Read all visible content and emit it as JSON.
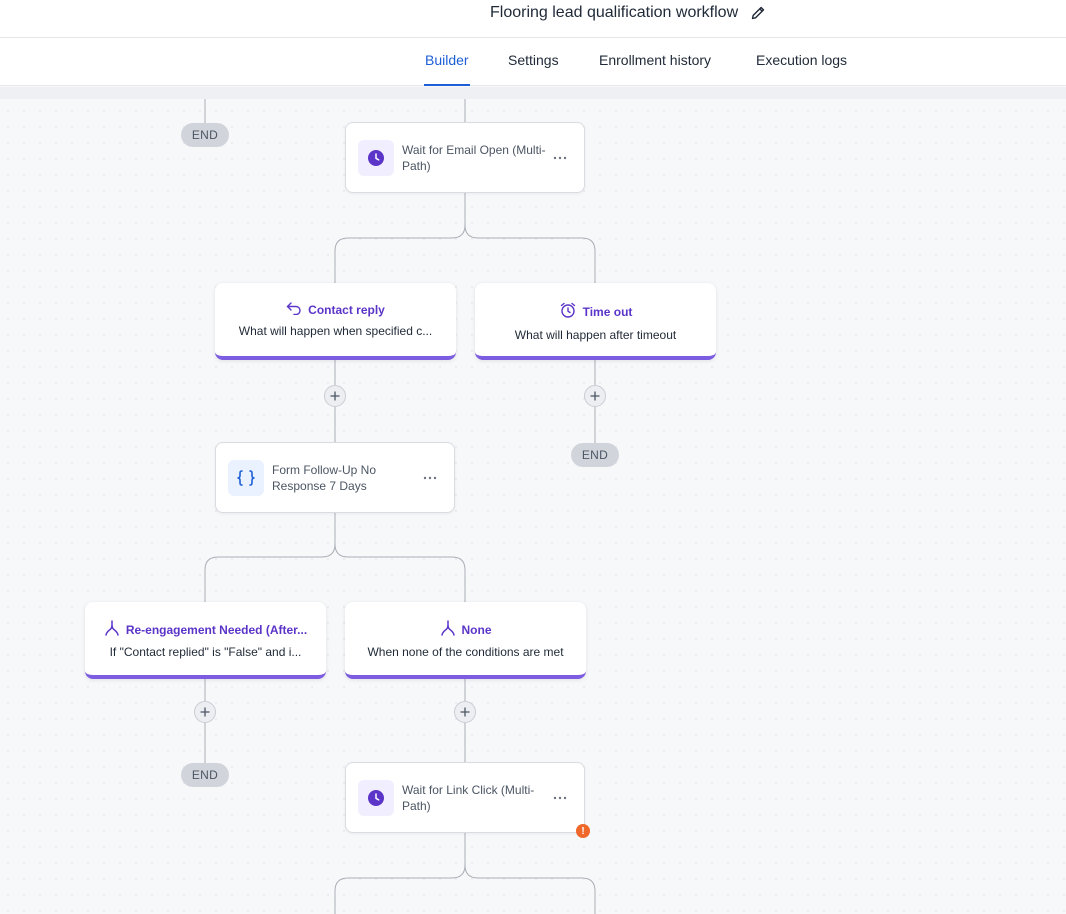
{
  "header": {
    "title": "Flooring lead qualification workflow",
    "edit_icon": "pencil-icon"
  },
  "tabs": [
    {
      "label": "Builder",
      "active": true
    },
    {
      "label": "Settings",
      "active": false
    },
    {
      "label": "Enrollment history",
      "active": false
    },
    {
      "label": "Execution logs",
      "active": false
    }
  ],
  "colors": {
    "accent": "#1d5fd6",
    "branch_accent": "#5b34c8",
    "branch_border": "#7c5ce0",
    "warning": "#f0672a",
    "end_pill": "#d1d5db"
  },
  "workflow": {
    "end_label": "END",
    "wait_email": {
      "label": "Wait for Email Open (Multi-Path)",
      "icon": "clock-icon"
    },
    "branch_contact_reply": {
      "title": "Contact reply",
      "description": "What will happen when specified c...",
      "icon": "reply-arrow-icon"
    },
    "branch_timeout": {
      "title": "Time out",
      "description": "What will happen after timeout",
      "icon": "alarm-clock-icon"
    },
    "form_followup": {
      "label": "Form Follow-Up No Response 7 Days",
      "icon": "curly-braces-icon"
    },
    "branch_reengagement": {
      "title": "Re-engagement Needed (After...",
      "description": "If \"Contact replied\" is \"False\" and i...",
      "icon": "split-branch-icon"
    },
    "branch_none": {
      "title": "None",
      "description": "When none of the conditions are met",
      "icon": "split-branch-icon"
    },
    "wait_link": {
      "label": "Wait for Link Click (Multi-Path)",
      "icon": "clock-icon",
      "warning_symbol": "!"
    }
  }
}
